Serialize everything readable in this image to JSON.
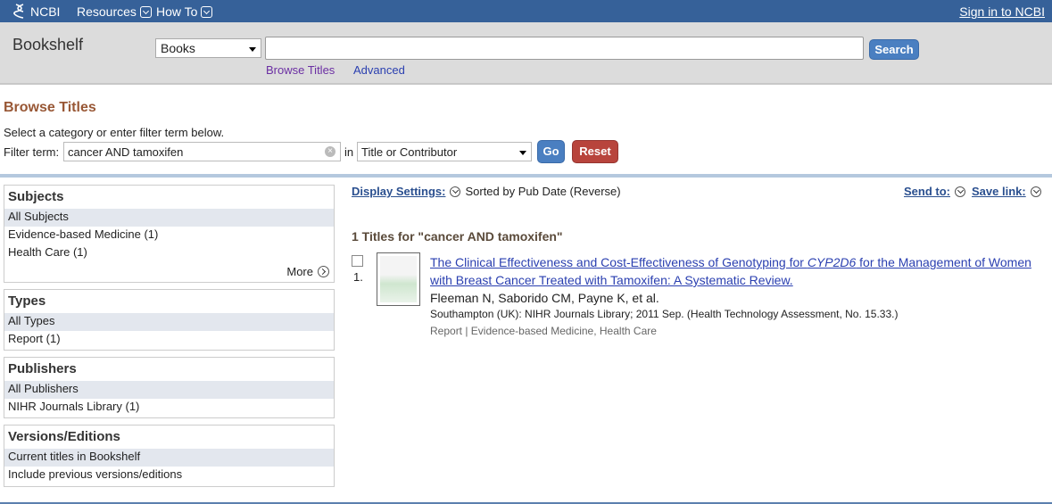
{
  "topbar": {
    "logo": "NCBI",
    "menus": [
      "Resources",
      "How To"
    ],
    "signin": "Sign in to NCBI"
  },
  "search": {
    "app_name": "Bookshelf",
    "database": "Books",
    "query": "",
    "button": "Search",
    "links": [
      "Browse Titles",
      "Advanced"
    ]
  },
  "browse": {
    "title": "Browse Titles",
    "instructions": "Select a category or enter filter term below.",
    "filter_label": "Filter term:",
    "filter_value": "cancer AND tamoxifen",
    "in_label": "in",
    "field": "Title or Contributor",
    "go": "Go",
    "reset": "Reset"
  },
  "facets": [
    {
      "title": "Subjects",
      "items": [
        "All Subjects",
        "Evidence-based Medicine (1)",
        "Health Care (1)"
      ],
      "more": "More"
    },
    {
      "title": "Types",
      "items": [
        "All Types",
        "Report (1)"
      ]
    },
    {
      "title": "Publishers",
      "items": [
        "All Publishers",
        "NIHR Journals Library (1)"
      ]
    },
    {
      "title": "Versions/Editions",
      "items": [
        "Current titles in Bookshelf",
        "Include previous versions/editions"
      ]
    }
  ],
  "results": {
    "display_settings": "Display Settings:",
    "sort": "Sorted by Pub Date (Reverse)",
    "send_to": "Send to:",
    "save_link": "Save link:",
    "count": "1 Titles for \"cancer AND tamoxifen\"",
    "items": [
      {
        "number": "1.",
        "title_pre": "The Clinical Effectiveness and Cost-Effectiveness of Genotyping for ",
        "title_em": "CYP2D6",
        "title_post": " for the Management of Women with Breast Cancer Treated with Tamoxifen: A Systematic Review.",
        "authors": "Fleeman N, Saborido CM, Payne K, et al.",
        "citation": "Southampton (UK): NIHR Journals Library; 2011 Sep. (Health Technology Assessment, No. 15.33.)",
        "meta": "Report | Evidence-based Medicine, Health Care"
      }
    ]
  },
  "colors": {
    "topbar": "#366199",
    "header": "#dcdcdc",
    "title_brown": "#985735",
    "button_blue": "#4a7fc1",
    "reset_red": "#b8443c"
  }
}
